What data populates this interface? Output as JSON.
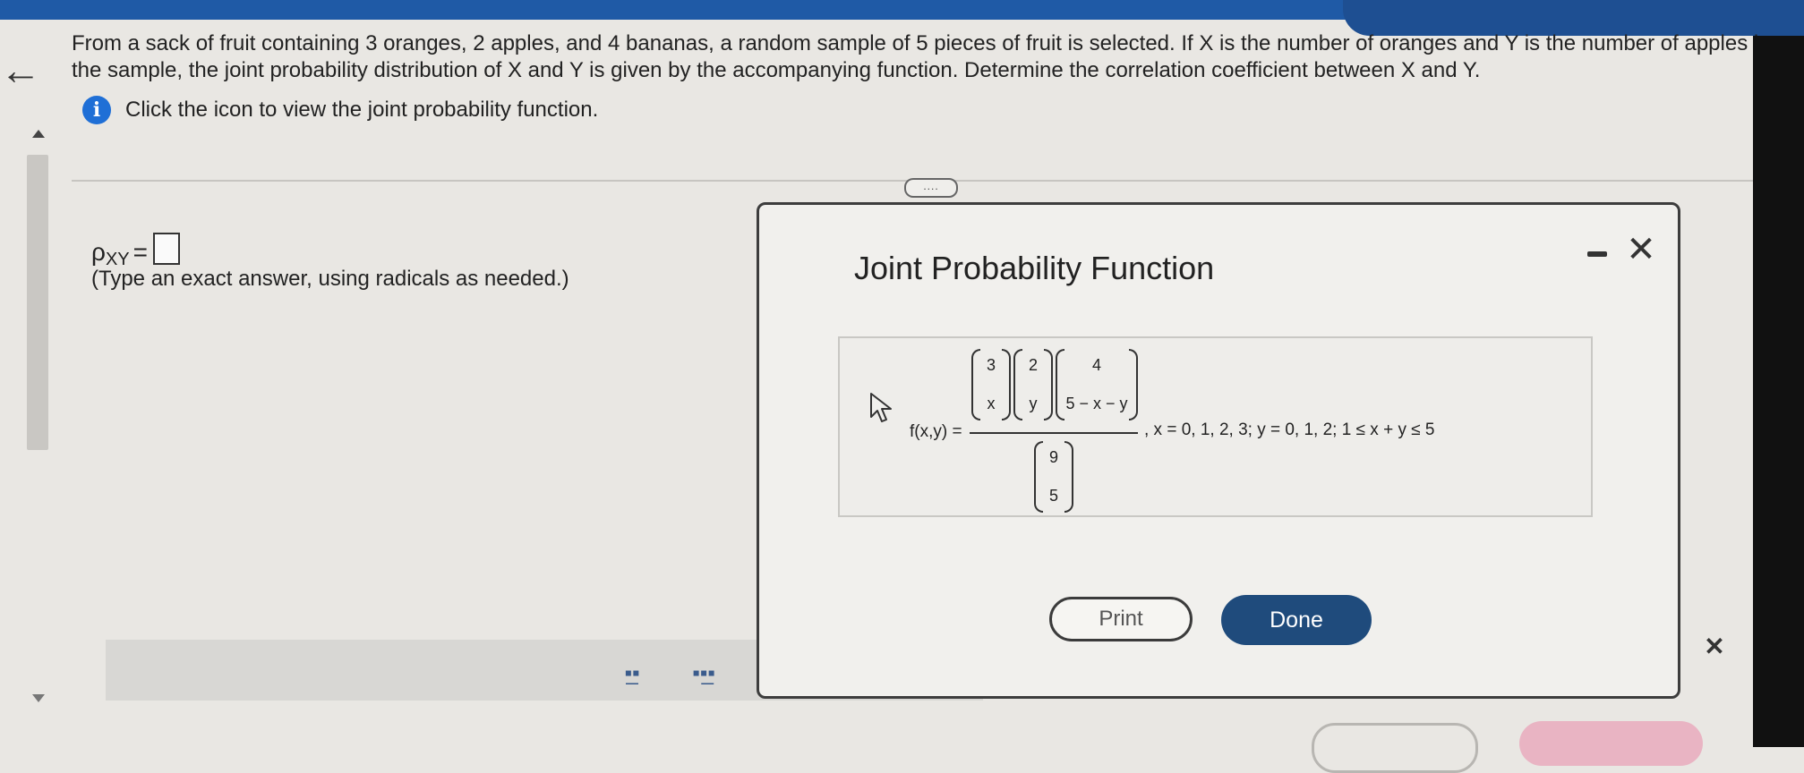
{
  "question": {
    "text": "From a sack of fruit containing 3 oranges, 2 apples, and 4 bananas, a random sample of 5 pieces of fruit is selected. If X is the number of oranges and Y is the number of apples in the sample, the joint probability distribution of X and Y is given by the accompanying function. Determine the correlation coefficient between X and Y.",
    "hint": "Click the icon to view the joint probability function."
  },
  "answer": {
    "symbol": "ρ",
    "subscript": "XY",
    "equals": "=",
    "note": "(Type an exact answer, using radicals as needed.)"
  },
  "expand_label": "....",
  "dialog": {
    "title": "Joint Probability Function",
    "formula_label": "f(x,y) =",
    "binom_a": {
      "top": "3",
      "bottom": "x"
    },
    "binom_b": {
      "top": "2",
      "bottom": "y"
    },
    "binom_c": {
      "top": "4",
      "bottom": "5 − x − y"
    },
    "binom_d": {
      "top": "9",
      "bottom": "5"
    },
    "condition": ", x = 0, 1, 2, 3; y = 0, 1, 2; 1 ≤ x + y ≤ 5",
    "print_label": "Print",
    "done_label": "Done"
  },
  "toolbar": {
    "fraction_icon": "▪̲▪",
    "mixed_icon": "▪▪̲▪"
  },
  "icons": {
    "back": "←",
    "info": "i",
    "close": "✕",
    "page_close": "✕"
  },
  "colors": {
    "accent": "#1f6fd6",
    "done_button": "#1f4b7c",
    "topbar": "#1f5aa6"
  }
}
